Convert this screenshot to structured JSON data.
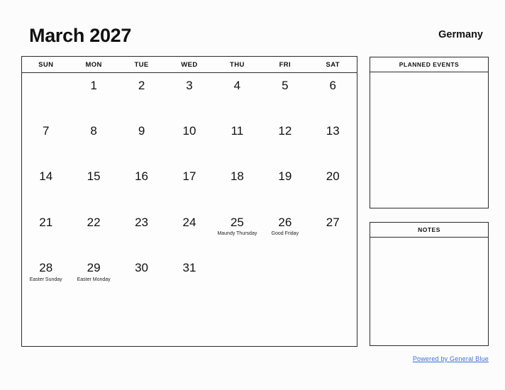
{
  "header": {
    "month_title": "March 2027",
    "country": "Germany"
  },
  "calendar": {
    "weekdays": [
      "SUN",
      "MON",
      "TUE",
      "WED",
      "THU",
      "FRI",
      "SAT"
    ],
    "weeks": [
      [
        {
          "day": ""
        },
        {
          "day": "1"
        },
        {
          "day": "2"
        },
        {
          "day": "3"
        },
        {
          "day": "4"
        },
        {
          "day": "5"
        },
        {
          "day": "6"
        }
      ],
      [
        {
          "day": "7"
        },
        {
          "day": "8"
        },
        {
          "day": "9"
        },
        {
          "day": "10"
        },
        {
          "day": "11"
        },
        {
          "day": "12"
        },
        {
          "day": "13"
        }
      ],
      [
        {
          "day": "14"
        },
        {
          "day": "15"
        },
        {
          "day": "16"
        },
        {
          "day": "17"
        },
        {
          "day": "18"
        },
        {
          "day": "19"
        },
        {
          "day": "20"
        }
      ],
      [
        {
          "day": "21"
        },
        {
          "day": "22"
        },
        {
          "day": "23"
        },
        {
          "day": "24"
        },
        {
          "day": "25",
          "event": "Maundy Thursday"
        },
        {
          "day": "26",
          "event": "Good Friday"
        },
        {
          "day": "27"
        }
      ],
      [
        {
          "day": "28",
          "event": "Easter Sunday"
        },
        {
          "day": "29",
          "event": "Easter Monday"
        },
        {
          "day": "30"
        },
        {
          "day": "31"
        },
        {
          "day": ""
        },
        {
          "day": ""
        },
        {
          "day": ""
        }
      ],
      [
        {
          "day": ""
        },
        {
          "day": ""
        },
        {
          "day": ""
        },
        {
          "day": ""
        },
        {
          "day": ""
        },
        {
          "day": ""
        },
        {
          "day": ""
        }
      ]
    ]
  },
  "panels": {
    "planned_events": {
      "title": "PLANNED EVENTS",
      "content": ""
    },
    "notes": {
      "title": "NOTES",
      "content": ""
    }
  },
  "footer": {
    "link_text": "Powered by General Blue"
  },
  "colors": {
    "page_background": "#fcfcfc",
    "border": "#2b2b2b",
    "text": "#111111",
    "link": "#3b6fd4"
  }
}
